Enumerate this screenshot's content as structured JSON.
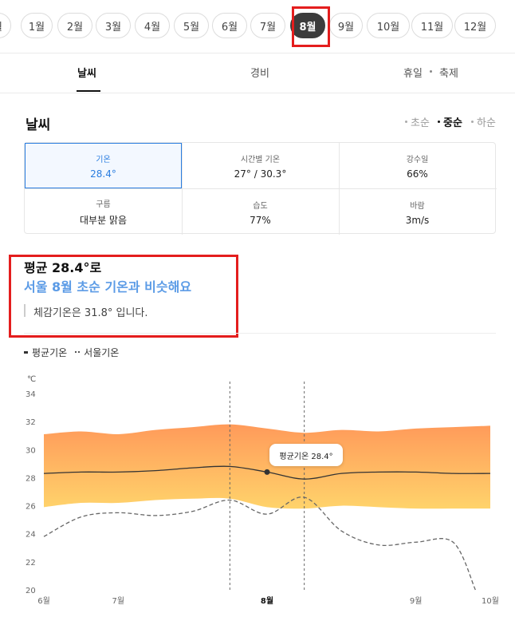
{
  "months": [
    {
      "label": "월",
      "active": false
    },
    {
      "label": "1월",
      "active": false
    },
    {
      "label": "2월",
      "active": false
    },
    {
      "label": "3월",
      "active": false
    },
    {
      "label": "4월",
      "active": false
    },
    {
      "label": "5월",
      "active": false
    },
    {
      "label": "6월",
      "active": false
    },
    {
      "label": "7월",
      "active": false
    },
    {
      "label": "8월",
      "active": true
    },
    {
      "label": "9월",
      "active": false
    },
    {
      "label": "10월",
      "active": false
    },
    {
      "label": "11월",
      "active": false
    },
    {
      "label": "12월",
      "active": false
    }
  ],
  "tabs": {
    "weather": "날씨",
    "cost": "경비",
    "holiday": "휴일",
    "festival": "축제"
  },
  "weather": {
    "title": "날씨",
    "periods": {
      "early": "초순",
      "mid": "중순",
      "late": "하순",
      "active": "중순"
    },
    "cells": {
      "temp": {
        "label": "기온",
        "value": "28.4°"
      },
      "hourly": {
        "label": "시간별 기온",
        "value": "27° / 30.3°"
      },
      "rain": {
        "label": "강수일",
        "value": "66%"
      },
      "cloud": {
        "label": "구름",
        "value": "대부분 맑음"
      },
      "humidity": {
        "label": "습도",
        "value": "77%"
      },
      "wind": {
        "label": "바람",
        "value": "3m/s"
      }
    }
  },
  "summary": {
    "line1": "평균 28.4°로",
    "line2": "서울 8월 초순 기온과 비슷해요",
    "line3": "체감기온은 31.8° 입니다."
  },
  "legend": {
    "avg": "평균기온",
    "seoul": "서울기온"
  },
  "tooltip": "평균기온 28.4°",
  "colors": {
    "accent": "#2a7de0",
    "summary_blue": "#5b9be6",
    "highlight_red": "#e41d1d",
    "band_top": "#ff9a5a",
    "band_bottom": "#ffd36b"
  },
  "chart_data": {
    "type": "area",
    "unit": "℃",
    "y_ticks": [
      34,
      32,
      30,
      28,
      26,
      24,
      22,
      20
    ],
    "ylim": [
      20,
      34
    ],
    "x_labels": [
      "6월",
      "7월",
      "8월",
      "9월",
      "10월"
    ],
    "x_label_positions": [
      0,
      0.5,
      1.5,
      2.5,
      3.0
    ],
    "highlight_x": "8월",
    "period_markers": [
      1.25,
      1.75
    ],
    "series": [
      {
        "name": "평균기온",
        "style": "solid",
        "x": [
          0,
          0.25,
          0.5,
          0.75,
          1.0,
          1.25,
          1.5,
          1.75,
          2.0,
          2.25,
          2.5,
          2.75,
          3.0
        ],
        "y": [
          28.3,
          28.4,
          28.4,
          28.5,
          28.7,
          28.8,
          28.4,
          27.9,
          28.3,
          28.4,
          28.4,
          28.3,
          28.3
        ]
      },
      {
        "name": "서울기온",
        "style": "dashed",
        "x": [
          0,
          0.25,
          0.5,
          0.75,
          1.0,
          1.25,
          1.5,
          1.75,
          2.0,
          2.25,
          2.5,
          2.75,
          2.9
        ],
        "y": [
          23.8,
          25.2,
          25.5,
          25.3,
          25.6,
          26.4,
          25.4,
          26.6,
          24.2,
          23.2,
          23.4,
          23.4,
          20.0
        ]
      },
      {
        "name": "band_upper",
        "style": "area",
        "x": [
          0,
          0.25,
          0.5,
          0.75,
          1.0,
          1.25,
          1.5,
          1.75,
          2.0,
          2.25,
          2.5,
          2.75,
          3.0
        ],
        "y": [
          31.1,
          31.3,
          31.1,
          31.4,
          31.6,
          31.8,
          31.5,
          31.2,
          31.4,
          31.3,
          31.5,
          31.6,
          31.7
        ]
      },
      {
        "name": "band_lower",
        "style": "area",
        "x": [
          0,
          0.25,
          0.5,
          0.75,
          1.0,
          1.25,
          1.5,
          1.75,
          2.0,
          2.25,
          2.5,
          2.75,
          3.0
        ],
        "y": [
          25.9,
          26.2,
          26.2,
          26.4,
          26.5,
          26.5,
          25.9,
          25.8,
          26.0,
          25.9,
          25.8,
          25.8,
          25.8
        ]
      }
    ],
    "point": {
      "x": 1.5,
      "y": 28.4
    }
  }
}
